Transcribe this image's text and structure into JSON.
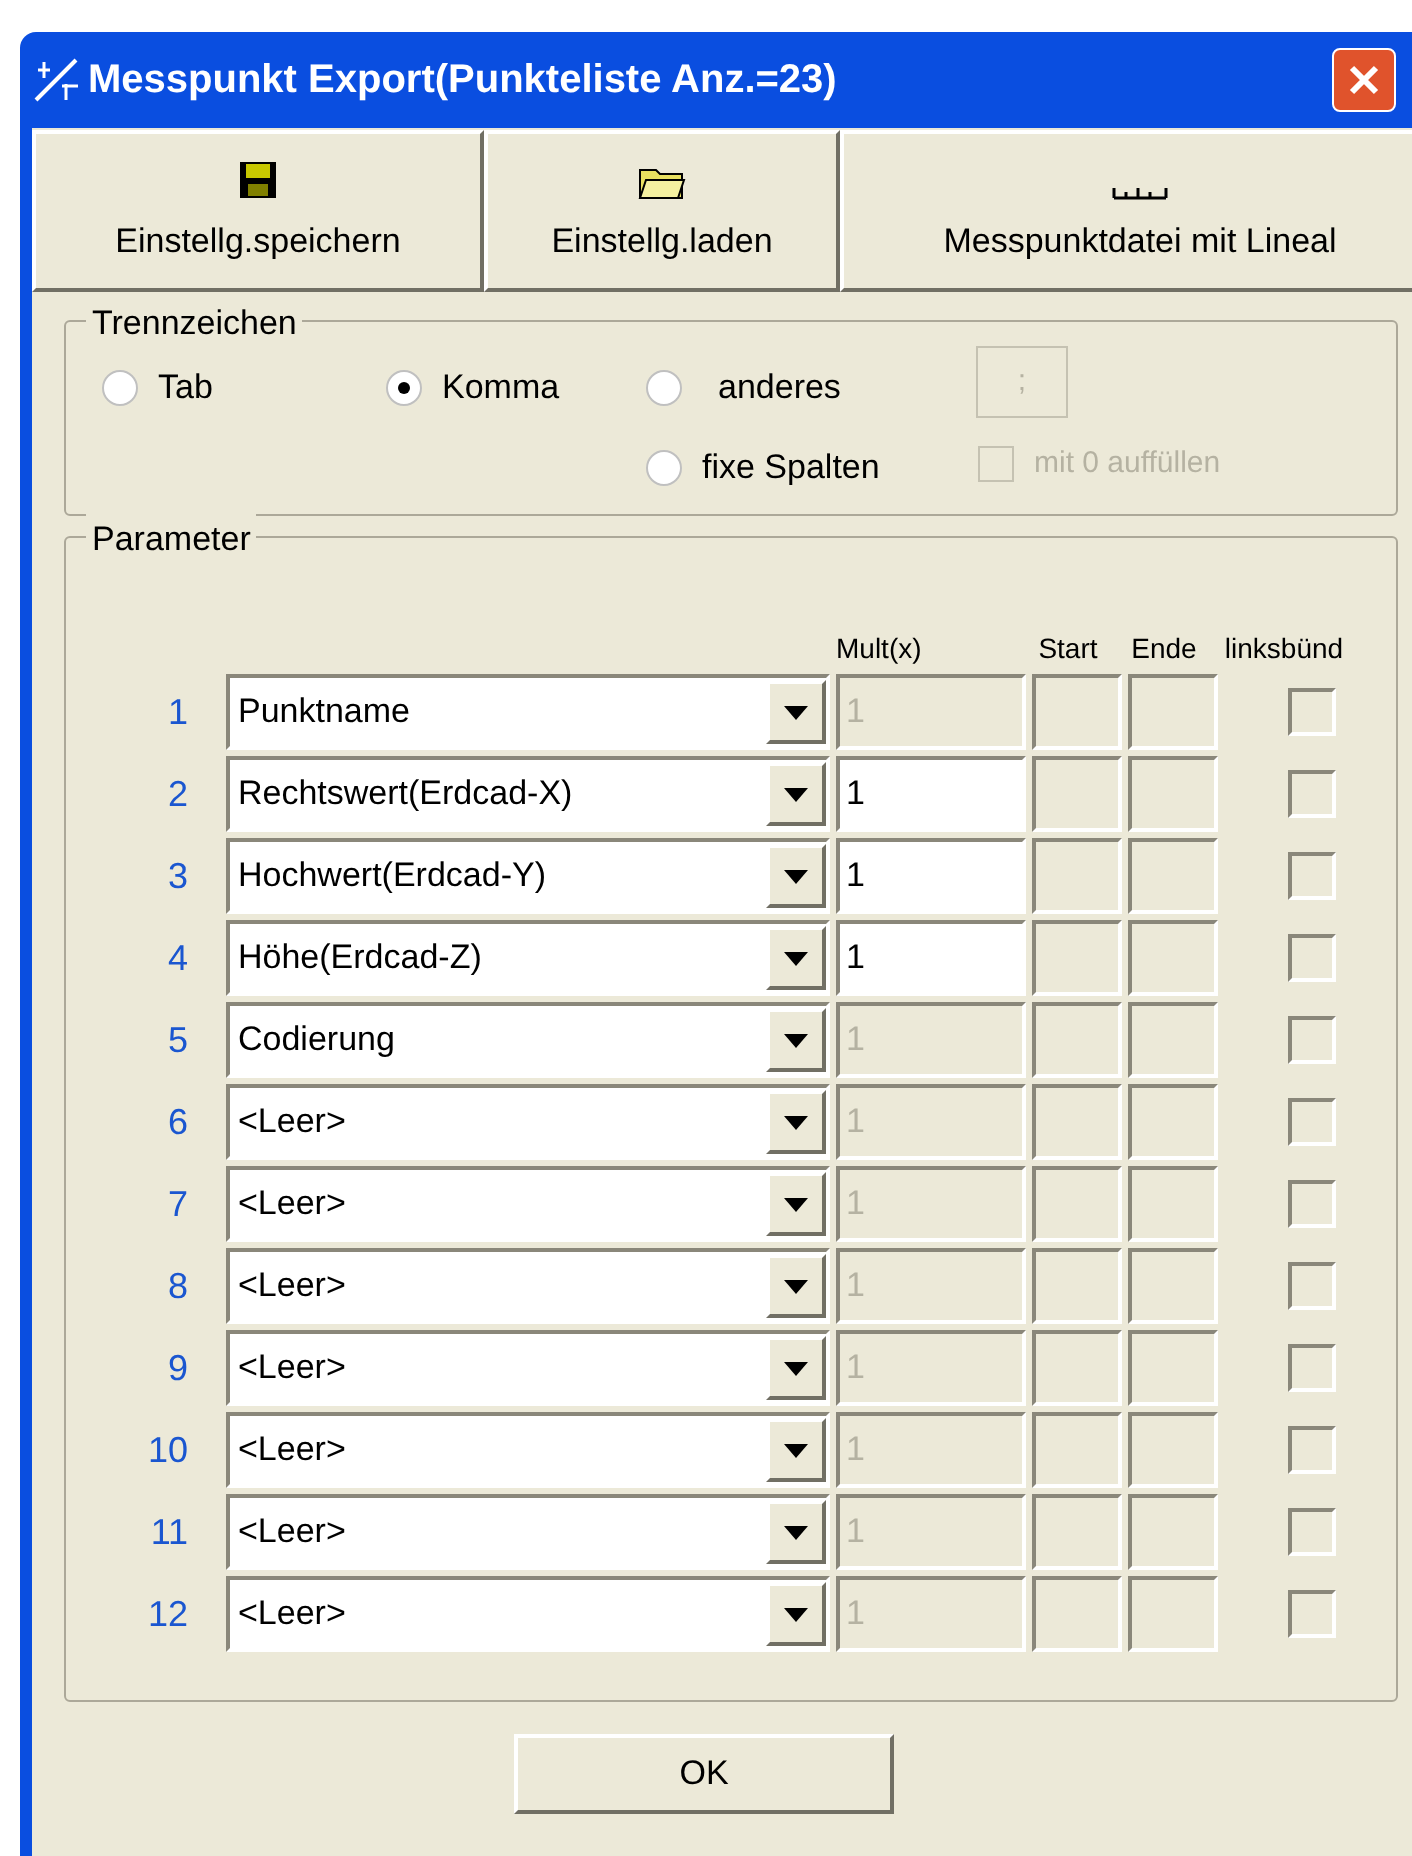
{
  "window": {
    "title": "Messpunkt Export(Punkteliste Anz.=23)"
  },
  "toolbar": [
    {
      "label": "Einstellg.speichern",
      "kind": "save"
    },
    {
      "label": "Einstellg.laden",
      "kind": "open"
    },
    {
      "label": "Messpunktdatei mit Lineal",
      "kind": "ruler"
    }
  ],
  "separator": {
    "title": "Trennzeichen",
    "options": [
      {
        "label": "Tab",
        "selected": false
      },
      {
        "label": "Komma",
        "selected": true
      },
      {
        "label": "anderes",
        "selected": false
      },
      {
        "label": "fixe Spalten",
        "selected": false
      }
    ],
    "other_value": ";",
    "pad_zeros": {
      "label": "mit 0 auffüllen",
      "checked": false,
      "disabled": true
    }
  },
  "parameters": {
    "title": "Parameter",
    "columns": [
      "Mult(x)",
      "Start",
      "Ende",
      "linksbünd"
    ],
    "rows": [
      {
        "number": "1",
        "field": "Punktname",
        "mult": "1",
        "mult_disabled": true,
        "left_aligned": false
      },
      {
        "number": "2",
        "field": "Rechtswert(Erdcad-X)",
        "mult": "1",
        "mult_disabled": false,
        "left_aligned": false
      },
      {
        "number": "3",
        "field": "Hochwert(Erdcad-Y)",
        "mult": "1",
        "mult_disabled": false,
        "left_aligned": false
      },
      {
        "number": "4",
        "field": "Höhe(Erdcad-Z)",
        "mult": "1",
        "mult_disabled": false,
        "left_aligned": false
      },
      {
        "number": "5",
        "field": "Codierung",
        "mult": "1",
        "mult_disabled": true,
        "left_aligned": false
      },
      {
        "number": "6",
        "field": "<Leer>",
        "mult": "1",
        "mult_disabled": true,
        "left_aligned": false
      },
      {
        "number": "7",
        "field": "<Leer>",
        "mult": "1",
        "mult_disabled": true,
        "left_aligned": false
      },
      {
        "number": "8",
        "field": "<Leer>",
        "mult": "1",
        "mult_disabled": true,
        "left_aligned": false
      },
      {
        "number": "9",
        "field": "<Leer>",
        "mult": "1",
        "mult_disabled": true,
        "left_aligned": false
      },
      {
        "number": "10",
        "field": "<Leer>",
        "mult": "1",
        "mult_disabled": true,
        "left_aligned": false
      },
      {
        "number": "11",
        "field": "<Leer>",
        "mult": "1",
        "mult_disabled": true,
        "left_aligned": false
      },
      {
        "number": "12",
        "field": "<Leer>",
        "mult": "1",
        "mult_disabled": true,
        "left_aligned": false
      }
    ]
  },
  "ok_button": {
    "label": "OK"
  }
}
